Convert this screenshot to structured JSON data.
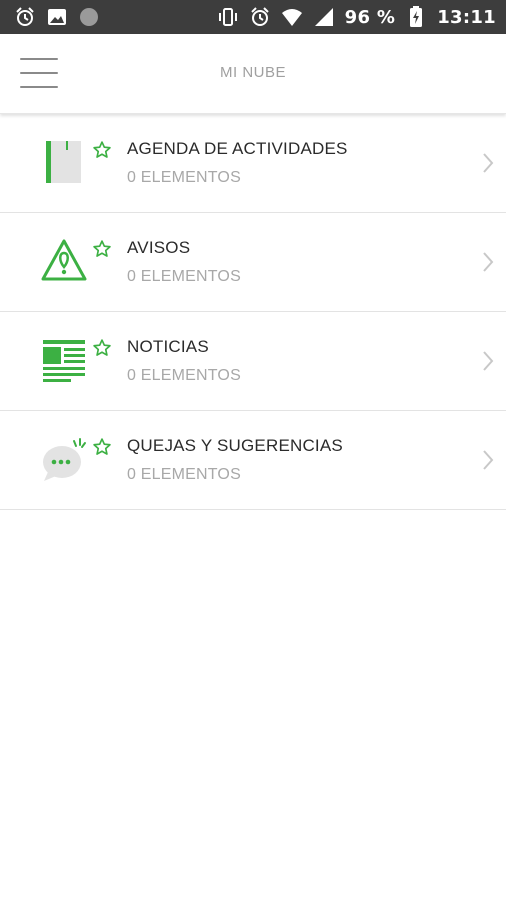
{
  "status_bar": {
    "battery_text": "96 %",
    "time": "13:11",
    "left_icons": [
      "alarm-icon",
      "image-icon",
      "circle-icon"
    ],
    "right_icons": [
      "vibrate-icon",
      "alarm-icon",
      "wifi-icon",
      "signal-icon",
      "battery-icon"
    ]
  },
  "app_bar": {
    "title": "MI NUBE",
    "menu_icon": "hamburger-menu-icon"
  },
  "accent_color": "#3cb043",
  "list": {
    "items": [
      {
        "title": "AGENDA DE ACTIVIDADES",
        "subtitle": "0 ELEMENTOS",
        "icon": "agenda-book-icon"
      },
      {
        "title": "AVISOS",
        "subtitle": "0 ELEMENTOS",
        "icon": "warning-triangle-icon"
      },
      {
        "title": "NOTICIAS",
        "subtitle": "0 ELEMENTOS",
        "icon": "newspaper-icon"
      },
      {
        "title": "QUEJAS Y SUGERENCIAS",
        "subtitle": "0 ELEMENTOS",
        "icon": "chat-bubble-icon"
      }
    ]
  }
}
